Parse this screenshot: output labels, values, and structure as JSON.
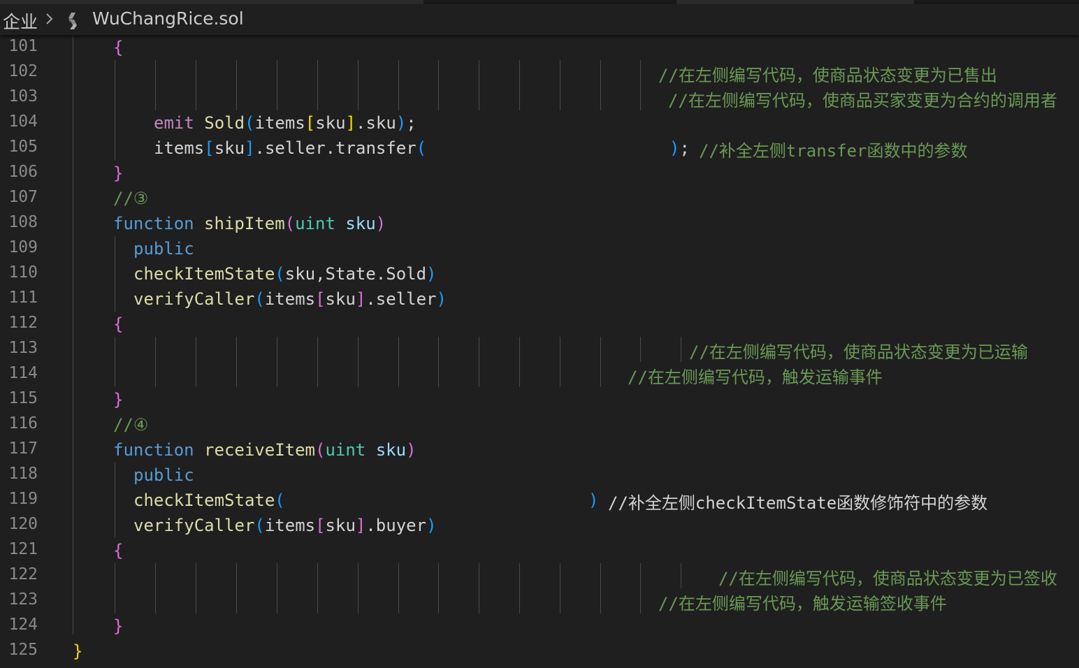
{
  "breadcrumb": {
    "folder": "企业",
    "separator": "›",
    "file_icon": "solidity-file-icon",
    "file": "WuChangRice.sol"
  },
  "editor": {
    "lines": [
      {
        "n": "101",
        "t": "{"
      },
      {
        "n": "102",
        "comment": "//在左侧编写代码，使商品状态变更为已售出"
      },
      {
        "n": "103",
        "comment": "//在左侧编写代码，使商品买家变更为合约的调用者"
      },
      {
        "n": "104",
        "kw": "emit",
        "fn": "Sold",
        "arg1": "items",
        "arg2": "sku",
        "prop": ".sku",
        "end": ";"
      },
      {
        "n": "105",
        "a": "items",
        "b": "sku",
        "c": ".seller.transfer",
        "end": ";",
        "comment": "//补全左侧transfer函数中的参数"
      },
      {
        "n": "106",
        "t": "}"
      },
      {
        "n": "107",
        "t": "//③"
      },
      {
        "n": "108",
        "kw": "function",
        "fn": "shipItem",
        "type": "uint",
        "param": "sku"
      },
      {
        "n": "109",
        "kw": "public"
      },
      {
        "n": "110",
        "fn": "checkItemState",
        "args": "sku,State.Sold"
      },
      {
        "n": "111",
        "fn": "verifyCaller",
        "a": "items",
        "b": "sku",
        "c": ".seller"
      },
      {
        "n": "112",
        "t": "{"
      },
      {
        "n": "113",
        "comment": "//在左侧编写代码，使商品状态变更为已运输"
      },
      {
        "n": "114",
        "comment": "//在左侧编写代码，触发运输事件"
      },
      {
        "n": "115",
        "t": "}"
      },
      {
        "n": "116",
        "t": "//④"
      },
      {
        "n": "117",
        "kw": "function",
        "fn": "receiveItem",
        "type": "uint",
        "param": "sku"
      },
      {
        "n": "118",
        "kw": "public"
      },
      {
        "n": "119",
        "fn": "checkItemState",
        "comment": "//补全左侧checkItemState函数修饰符中的参数"
      },
      {
        "n": "120",
        "fn": "verifyCaller",
        "a": "items",
        "b": "sku",
        "c": ".buyer"
      },
      {
        "n": "121",
        "t": "{"
      },
      {
        "n": "122",
        "comment": "//在左侧编写代码，使商品状态变更为已签收"
      },
      {
        "n": "123",
        "comment": "//在左侧编写代码，触发运输签收事件"
      },
      {
        "n": "124",
        "t": "}"
      },
      {
        "n": "125",
        "t": "}"
      }
    ]
  },
  "theme": {
    "background": "#1f1f1f",
    "keyword": "#569cd6",
    "function": "#dcdcaa",
    "comment": "#6a9955",
    "bracket_gold": "#ffd700",
    "bracket_purple": "#da70d6",
    "bracket_blue": "#179fff"
  }
}
